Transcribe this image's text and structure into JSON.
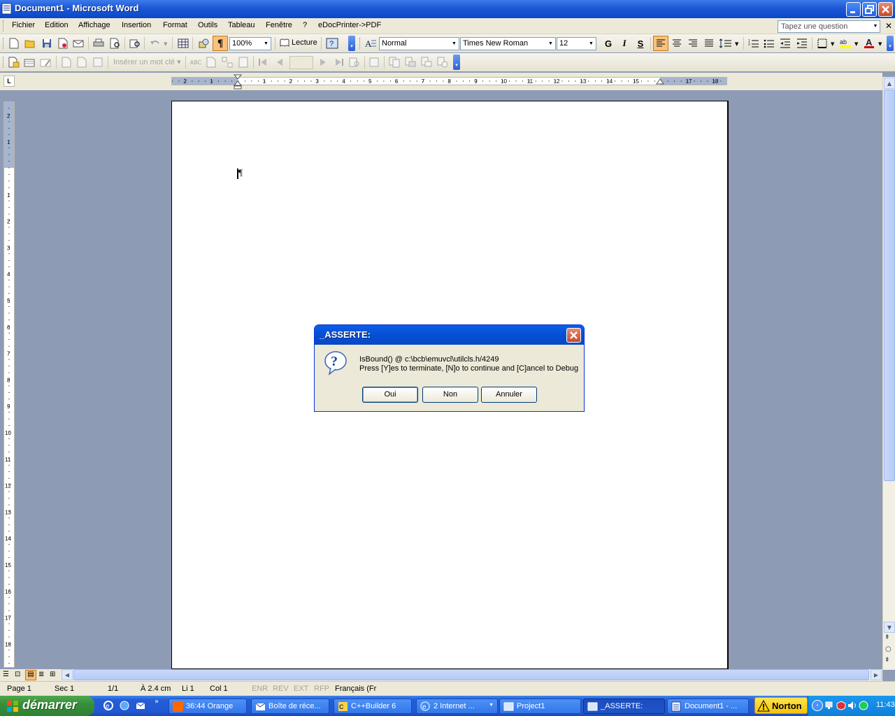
{
  "window": {
    "title": "Document1 - Microsoft Word"
  },
  "menubar": {
    "items": [
      "Fichier",
      "Edition",
      "Affichage",
      "Insertion",
      "Format",
      "Outils",
      "Tableau",
      "Fenêtre",
      "?",
      "eDocPrinter->PDF"
    ],
    "ask_placeholder": "Tapez une question"
  },
  "toolbar": {
    "zoom": "100%",
    "reading_label": "Lecture",
    "style": "Normal",
    "font": "Times New Roman",
    "size": "12",
    "bold_label": "G",
    "italic_label": "I",
    "underline_label": "S"
  },
  "toolbar2": {
    "insert_field_label": "Insérer un mot clé"
  },
  "ruler": {
    "h_labels": [
      "2",
      "1",
      "1",
      "2",
      "3",
      "4",
      "5",
      "6",
      "7",
      "8",
      "9",
      "10",
      "11",
      "12",
      "13",
      "14",
      "15",
      "17",
      "18"
    ],
    "v_labels_top": [
      "2",
      "1"
    ],
    "v_labels": [
      "1",
      "2",
      "3",
      "4",
      "5",
      "6",
      "7",
      "8",
      "9",
      "10",
      "11",
      "12",
      "13",
      "14",
      "15",
      "16",
      "17",
      "18"
    ]
  },
  "statusbar": {
    "page": "Page 1",
    "sec": "Sec 1",
    "pages": "1/1",
    "at": "À 2.4 cm",
    "line": "Li 1",
    "col": "Col 1",
    "rec": "ENR",
    "rev": "REV",
    "ext": "EXT",
    "ovr": "RFP",
    "lang": "Français (Fr"
  },
  "dialog": {
    "title": "_ASSERTE:",
    "line1": "IsBound() @ c:\\bcb\\emuvcl\\utilcls.h/4249",
    "line2": "Press [Y]es to terminate, [N]o to continue and [C]ancel to Debug",
    "buttons": {
      "yes": "Oui",
      "no": "Non",
      "cancel": "Annuler"
    }
  },
  "taskbar": {
    "start_label": "démarrer",
    "tasks": [
      "36:44 Orange",
      "Boîte de réce...",
      "C++Builder 6",
      "2 Internet ...",
      "Project1",
      "_ASSERTE:",
      "Document1 - ..."
    ],
    "norton_label": "Norton",
    "clock": "11:43"
  },
  "colors": {
    "title_blue": "#0a47c9",
    "start_green": "#35903b",
    "workspace": "#8e9bb5"
  }
}
